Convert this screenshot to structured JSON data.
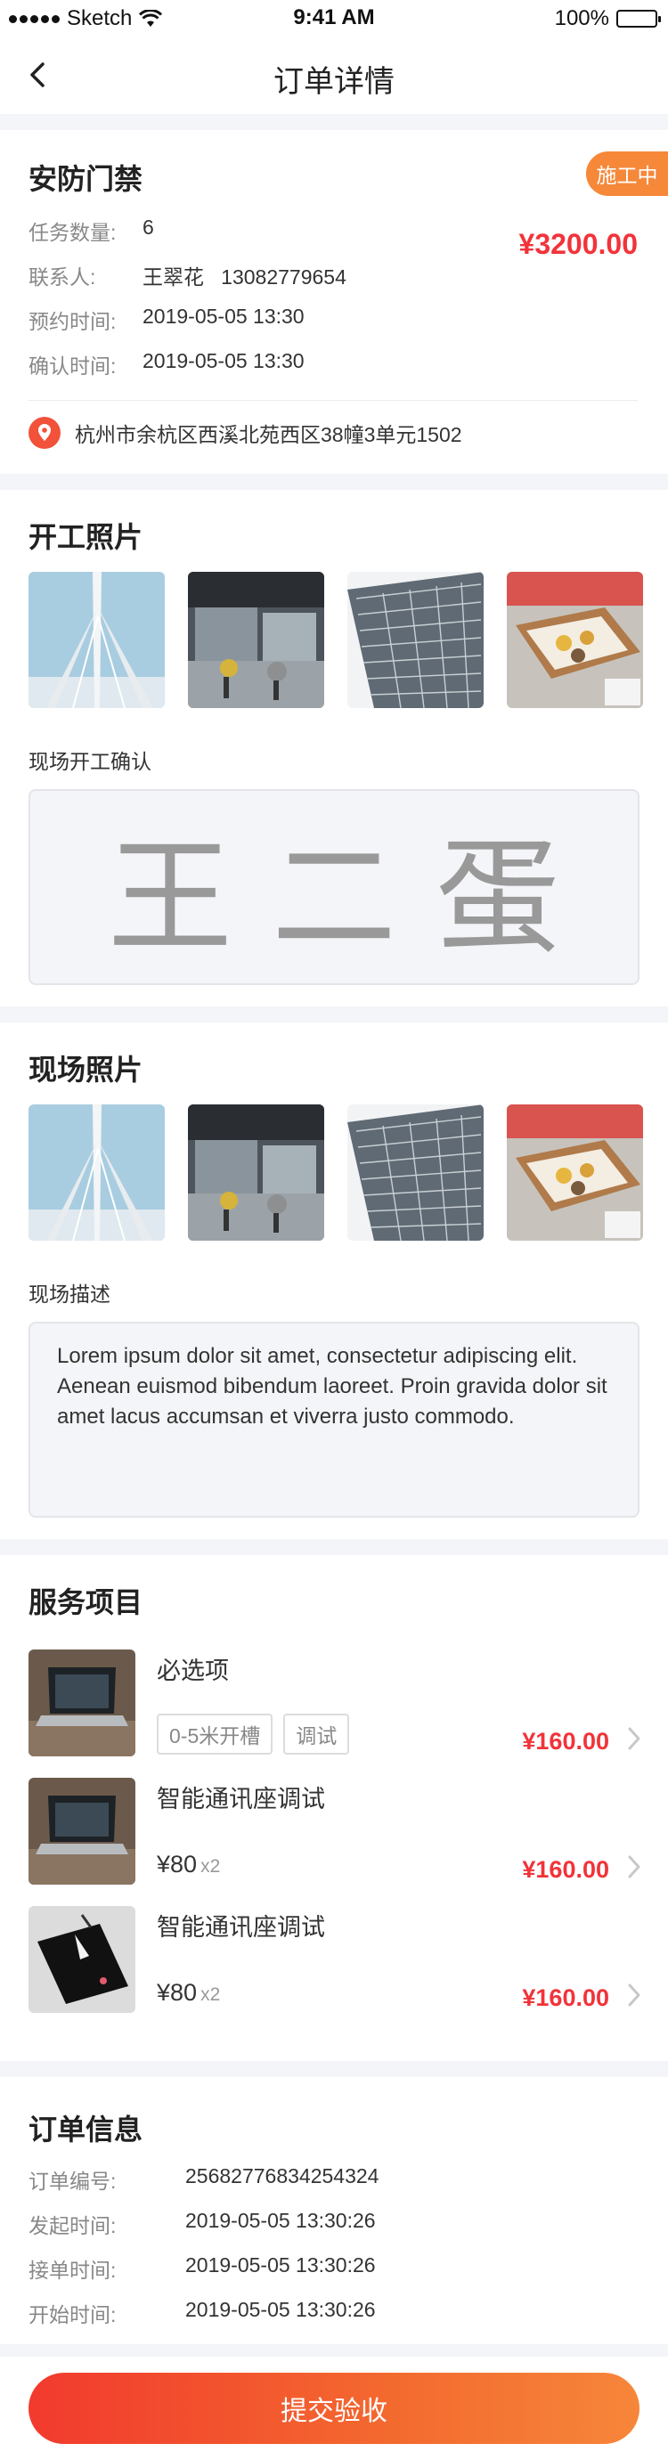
{
  "status_bar": {
    "carrier": "Sketch",
    "time": "9:41 AM",
    "battery": "100%"
  },
  "nav": {
    "title": "订单详情"
  },
  "order": {
    "service_name": "安防门禁",
    "status_badge": "施工中",
    "price": "¥3200.00",
    "fields": [
      {
        "label": "任务数量:",
        "value": "6"
      },
      {
        "label": "联系人:",
        "value": "王翠花   13082779654"
      },
      {
        "label": "预约时间:",
        "value": "2019-05-05 13:30"
      },
      {
        "label": "确认时间:",
        "value": "2019-05-05 13:30"
      }
    ],
    "address": "杭州市余杭区西溪北苑西区38幢3单元1502"
  },
  "start_photos": {
    "title": "开工照片",
    "confirm_label": "现场开工确认",
    "signature": "王二蛋"
  },
  "site_photos": {
    "title": "现场照片",
    "desc_label": "现场描述",
    "description": "Lorem ipsum dolor sit amet, consectetur adipiscing elit. Aenean euismod bibendum laoreet. Proin gravida dolor sit amet lacus accumsan et viverra justo commodo."
  },
  "services": {
    "title": "服务项目",
    "items": [
      {
        "name": "必选项",
        "tags": [
          "0-5米开槽",
          "调试"
        ],
        "price": "¥160.00"
      },
      {
        "name": "智能通讯座调试",
        "unit_price": "¥80",
        "qty": "x2",
        "price": "¥160.00"
      },
      {
        "name": "智能通讯座调试",
        "unit_price": "¥80",
        "qty": "x2",
        "price": "¥160.00"
      }
    ]
  },
  "order_info": {
    "title": "订单信息",
    "rows": [
      {
        "label": "订单编号:",
        "value": "25682776834254324"
      },
      {
        "label": "发起时间:",
        "value": "2019-05-05 13:30:26"
      },
      {
        "label": "接单时间:",
        "value": "2019-05-05 13:30:26"
      },
      {
        "label": "开始时间:",
        "value": "2019-05-05 13:30:26"
      }
    ]
  },
  "submit_label": "提交验收",
  "icons": {
    "back": "chevron-left-icon",
    "location": "location-pin-icon",
    "row_arrow": "chevron-right-icon"
  },
  "colors": {
    "accent_red": "#f2333a",
    "badge_orange": "#f6883a"
  }
}
